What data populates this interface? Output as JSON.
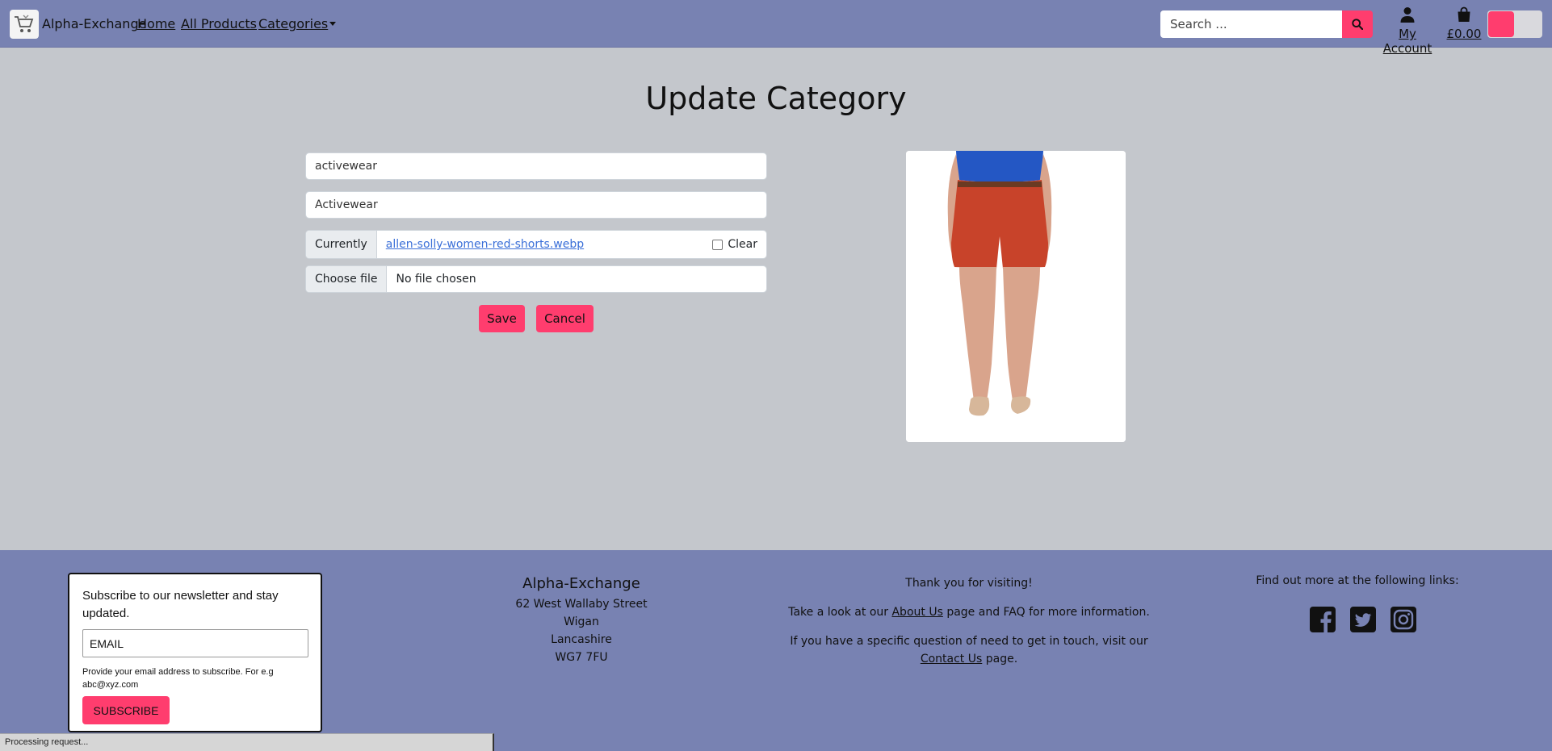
{
  "navbar": {
    "brand": "Alpha-Exchange",
    "links": {
      "home": "Home",
      "all_products": "All Products",
      "categories": "Categories"
    },
    "search_placeholder": "Search ...",
    "account_label": "My Account",
    "bag_total": "£0.00",
    "accent_color": "#ff3d6e"
  },
  "main": {
    "title": "Update Category",
    "fields": {
      "name_value": "activewear",
      "friendly_name_value": "Activewear"
    },
    "image": {
      "currently_label": "Currently",
      "current_file": "allen-solly-women-red-shorts.webp",
      "clear_label": "Clear",
      "choose_label": "Choose file",
      "no_file_label": "No file chosen"
    },
    "buttons": {
      "save": "Save",
      "cancel": "Cancel"
    }
  },
  "footer": {
    "subscribe": {
      "intro": "Subscribe to our newsletter and stay updated.",
      "email_placeholder": "EMAIL",
      "hint": "Provide your email address to subscribe. For e.g abc@xyz.com",
      "button": "SUBSCRIBE"
    },
    "address": {
      "name": "Alpha-Exchange",
      "lines": [
        "62 West Wallaby Street",
        "Wigan",
        "Lancashire",
        "WG7 7FU"
      ]
    },
    "info": {
      "thanks": "Thank you for visiting!",
      "about_pre": "Take a look at our ",
      "about_link": "About Us",
      "about_post": " page and FAQ for more information.",
      "contact_pre": "If you have a specific question of need to get in touch, visit our ",
      "contact_link": "Contact Us",
      "contact_post": " page."
    },
    "links_heading": "Find out more at the following links:",
    "social_icons": [
      "facebook-icon",
      "twitter-icon",
      "instagram-icon"
    ]
  },
  "status_bar": "Processing request..."
}
